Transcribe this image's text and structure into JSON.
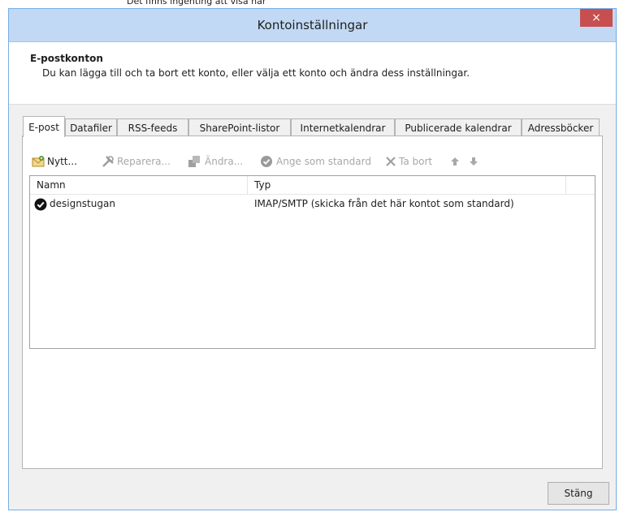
{
  "background_text": "Det finns ingenting att visa här",
  "dialog": {
    "title": "Kontoinställningar",
    "close_symbol": "×",
    "close_button_color": "#c74f50"
  },
  "header": {
    "title": "E-postkonton",
    "description": "Du kan lägga till och ta bort ett konto, eller välja ett konto och ändra dess inställningar."
  },
  "tabs": [
    {
      "label": "E-post",
      "active": true
    },
    {
      "label": "Datafiler"
    },
    {
      "label": "RSS-feeds"
    },
    {
      "label": "SharePoint-listor"
    },
    {
      "label": "Internetkalendrar"
    },
    {
      "label": "Publicerade kalendrar"
    },
    {
      "label": "Adressböcker"
    }
  ],
  "toolbar": {
    "new_label": "Nytt...",
    "repair_label": "Reparera...",
    "change_label": "Ändra...",
    "default_label": "Ange som standard",
    "remove_label": "Ta bort"
  },
  "list": {
    "columns": [
      "Namn",
      "Typ"
    ],
    "rows": [
      {
        "name": "designstugan",
        "type": "IMAP/SMTP (skicka från det här kontot som standard)"
      }
    ]
  },
  "footer": {
    "close_label": "Stäng"
  }
}
